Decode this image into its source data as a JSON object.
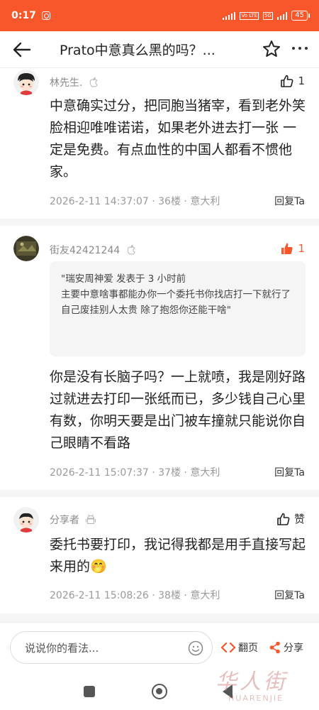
{
  "status_bar": {
    "time": "0:17",
    "net_tag_1": "Vo LTE",
    "net_tag_2": "5G",
    "battery": "45"
  },
  "header": {
    "title": "Prato中意真么黑的吗？..."
  },
  "comments": [
    {
      "user": "林先生.",
      "device_icon": "apple-icon",
      "likes": "1",
      "text": "中意确实过分，把同胞当猪宰，看到老外笑脸相迎唯唯诺诺，如果老外进去打一张 一定是免费。有点血性的中国人都看不惯他家。",
      "date": "2026-2-11 14:37:07",
      "floor": "36楼",
      "location": "意大利",
      "reply": "回复Ta"
    },
    {
      "user": "街友42421244",
      "device_icon": "apple-icon",
      "likes": "1",
      "liked": true,
      "quote": "\"瑞安周神爱 发表于 3 小时前\n主要中意啥事都能办你一个委托书你找店打一下就行了自己废挂别人太贵 除了抱怨你还能干啥\"",
      "text": "你是没有长脑子吗？一上就喷，我是刚好路过就进去打印一张纸而已，多少钱自己心里有数，你明天要是出门被车撞就只能说你自己眼睛不看路",
      "date": "2026-2-11 15:07:37",
      "floor": "37楼",
      "location": "意大利",
      "reply": "回复Ta"
    },
    {
      "user": "分享者",
      "device_icon": "android-icon",
      "likes": "赞",
      "text": "委托书要打印，我记得我都是用手直接写起来用的🤭",
      "date": "2026-2-11 15:08:26",
      "floor": "38楼",
      "location": "意大利",
      "reply": "回复Ta"
    }
  ],
  "bottom_bar": {
    "input_placeholder": "说说你的看法...",
    "flip_label": "翻页",
    "share_label": "分享"
  },
  "watermark": {
    "cn": "华人街",
    "en": "HUARENJIE"
  },
  "colors": {
    "accent": "#f7572a",
    "text": "#222222",
    "meta": "#9a9a9a"
  }
}
